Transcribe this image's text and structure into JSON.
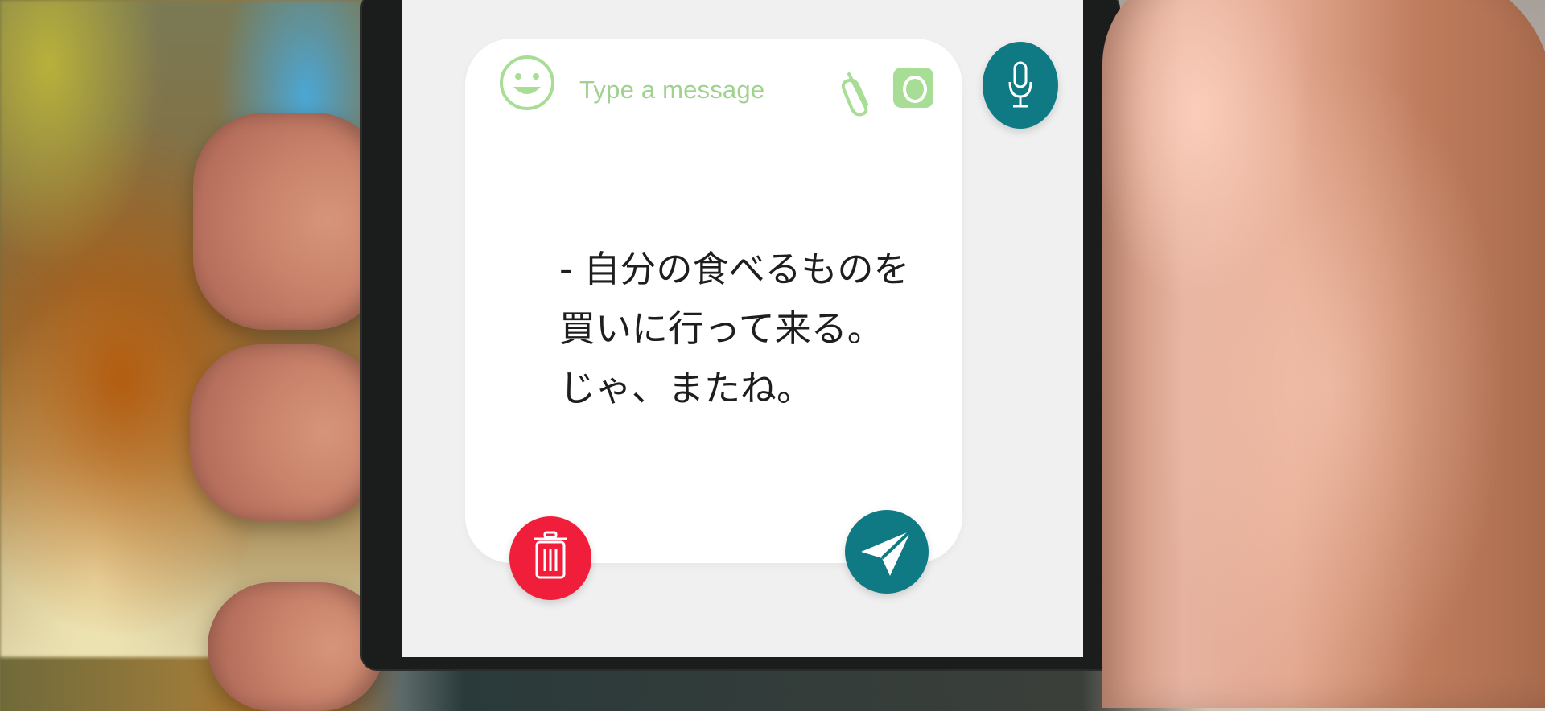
{
  "composer": {
    "placeholder": "Type a message",
    "message_lines": [
      "- 自分の食べるものを",
      "買いに行って来る。",
      "じゃ、またね。"
    ]
  },
  "icons": {
    "emoji": "emoji-smile-icon",
    "attach": "paperclip-icon",
    "camera": "camera-icon",
    "mic": "microphone-icon",
    "delete": "trash-icon",
    "send": "paper-plane-send-icon"
  },
  "colors": {
    "accent_green": "#9ed28e",
    "teal": "#0f7a84",
    "delete_red": "#f01e3a",
    "card_bg": "#ffffff",
    "screen_bg": "#f0f0f0"
  }
}
